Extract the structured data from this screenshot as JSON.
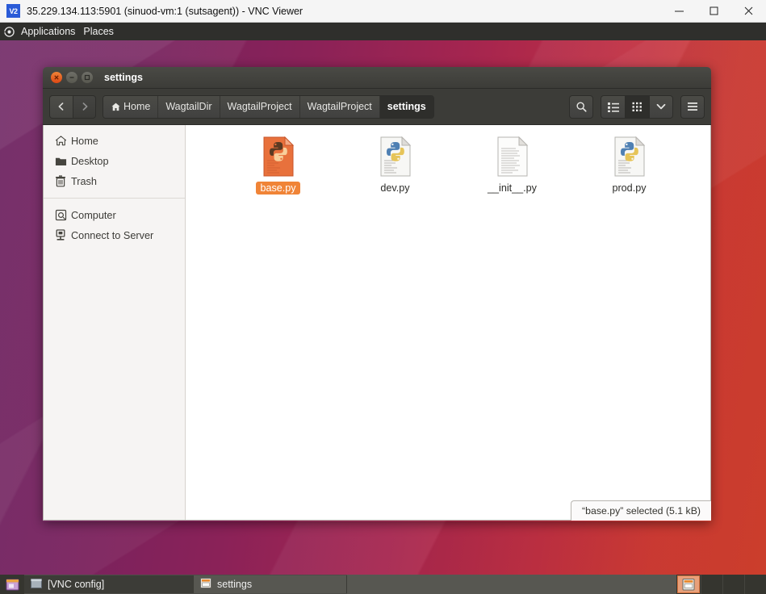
{
  "vnc": {
    "app_icon_label": "V2",
    "title": "35.229.134.113:5901 (sinuod-vm:1 (sutsagent)) - VNC Viewer",
    "controls": {
      "minimize": "minimize-window",
      "maximize": "maximize-window",
      "close": "close-window"
    }
  },
  "gnome_panel": {
    "applications_label": "Applications",
    "places_label": "Places"
  },
  "file_manager": {
    "window_title": "settings",
    "nav": {
      "back_label": "Back",
      "forward_label": "Forward"
    },
    "breadcrumbs": [
      {
        "label": "Home",
        "icon": "home-icon",
        "current": false
      },
      {
        "label": "WagtailDir",
        "icon": "",
        "current": false
      },
      {
        "label": "WagtailProject",
        "icon": "",
        "current": false
      },
      {
        "label": "WagtailProject",
        "icon": "",
        "current": false
      },
      {
        "label": "settings",
        "icon": "",
        "current": true
      }
    ],
    "toolbar_right": [
      {
        "name": "search-icon",
        "label": "Search"
      },
      {
        "name": "list-view-icon",
        "label": "List view"
      },
      {
        "name": "grid-view-icon",
        "label": "Icon view"
      },
      {
        "name": "chevron-down-icon",
        "label": "View options"
      },
      {
        "name": "hamburger-menu-icon",
        "label": "Menu"
      }
    ],
    "sidebar": {
      "items": [
        {
          "label": "Home",
          "icon": "home-icon"
        },
        {
          "label": "Desktop",
          "icon": "folder-icon"
        },
        {
          "label": "Trash",
          "icon": "trash-icon"
        }
      ],
      "items2": [
        {
          "label": "Computer",
          "icon": "computer-icon"
        },
        {
          "label": "Connect to Server",
          "icon": "server-icon"
        }
      ]
    },
    "files": [
      {
        "name": "base.py",
        "icon": "python-file-icon",
        "selected": true,
        "variant": "orange"
      },
      {
        "name": "dev.py",
        "icon": "python-file-icon",
        "selected": false,
        "variant": "normal"
      },
      {
        "name": "__init__.py",
        "icon": "text-file-icon",
        "selected": false,
        "variant": "plain"
      },
      {
        "name": "prod.py",
        "icon": "python-file-icon",
        "selected": false,
        "variant": "normal"
      }
    ],
    "status_text": "“base.py” selected  (5.1 kB)"
  },
  "taskbar": {
    "windows": [
      {
        "label": "[VNC config]",
        "icon": "window-icon"
      },
      {
        "label": "settings",
        "icon": "file-manager-icon"
      }
    ]
  },
  "colors": {
    "accent_orange": "#f08437",
    "selection": "#f08437",
    "panel_dark": "#2f2f2c",
    "titlebar_dark": "#3c3c38",
    "wallpaper_left": "#6d2462",
    "wallpaper_right": "#d2402c"
  }
}
